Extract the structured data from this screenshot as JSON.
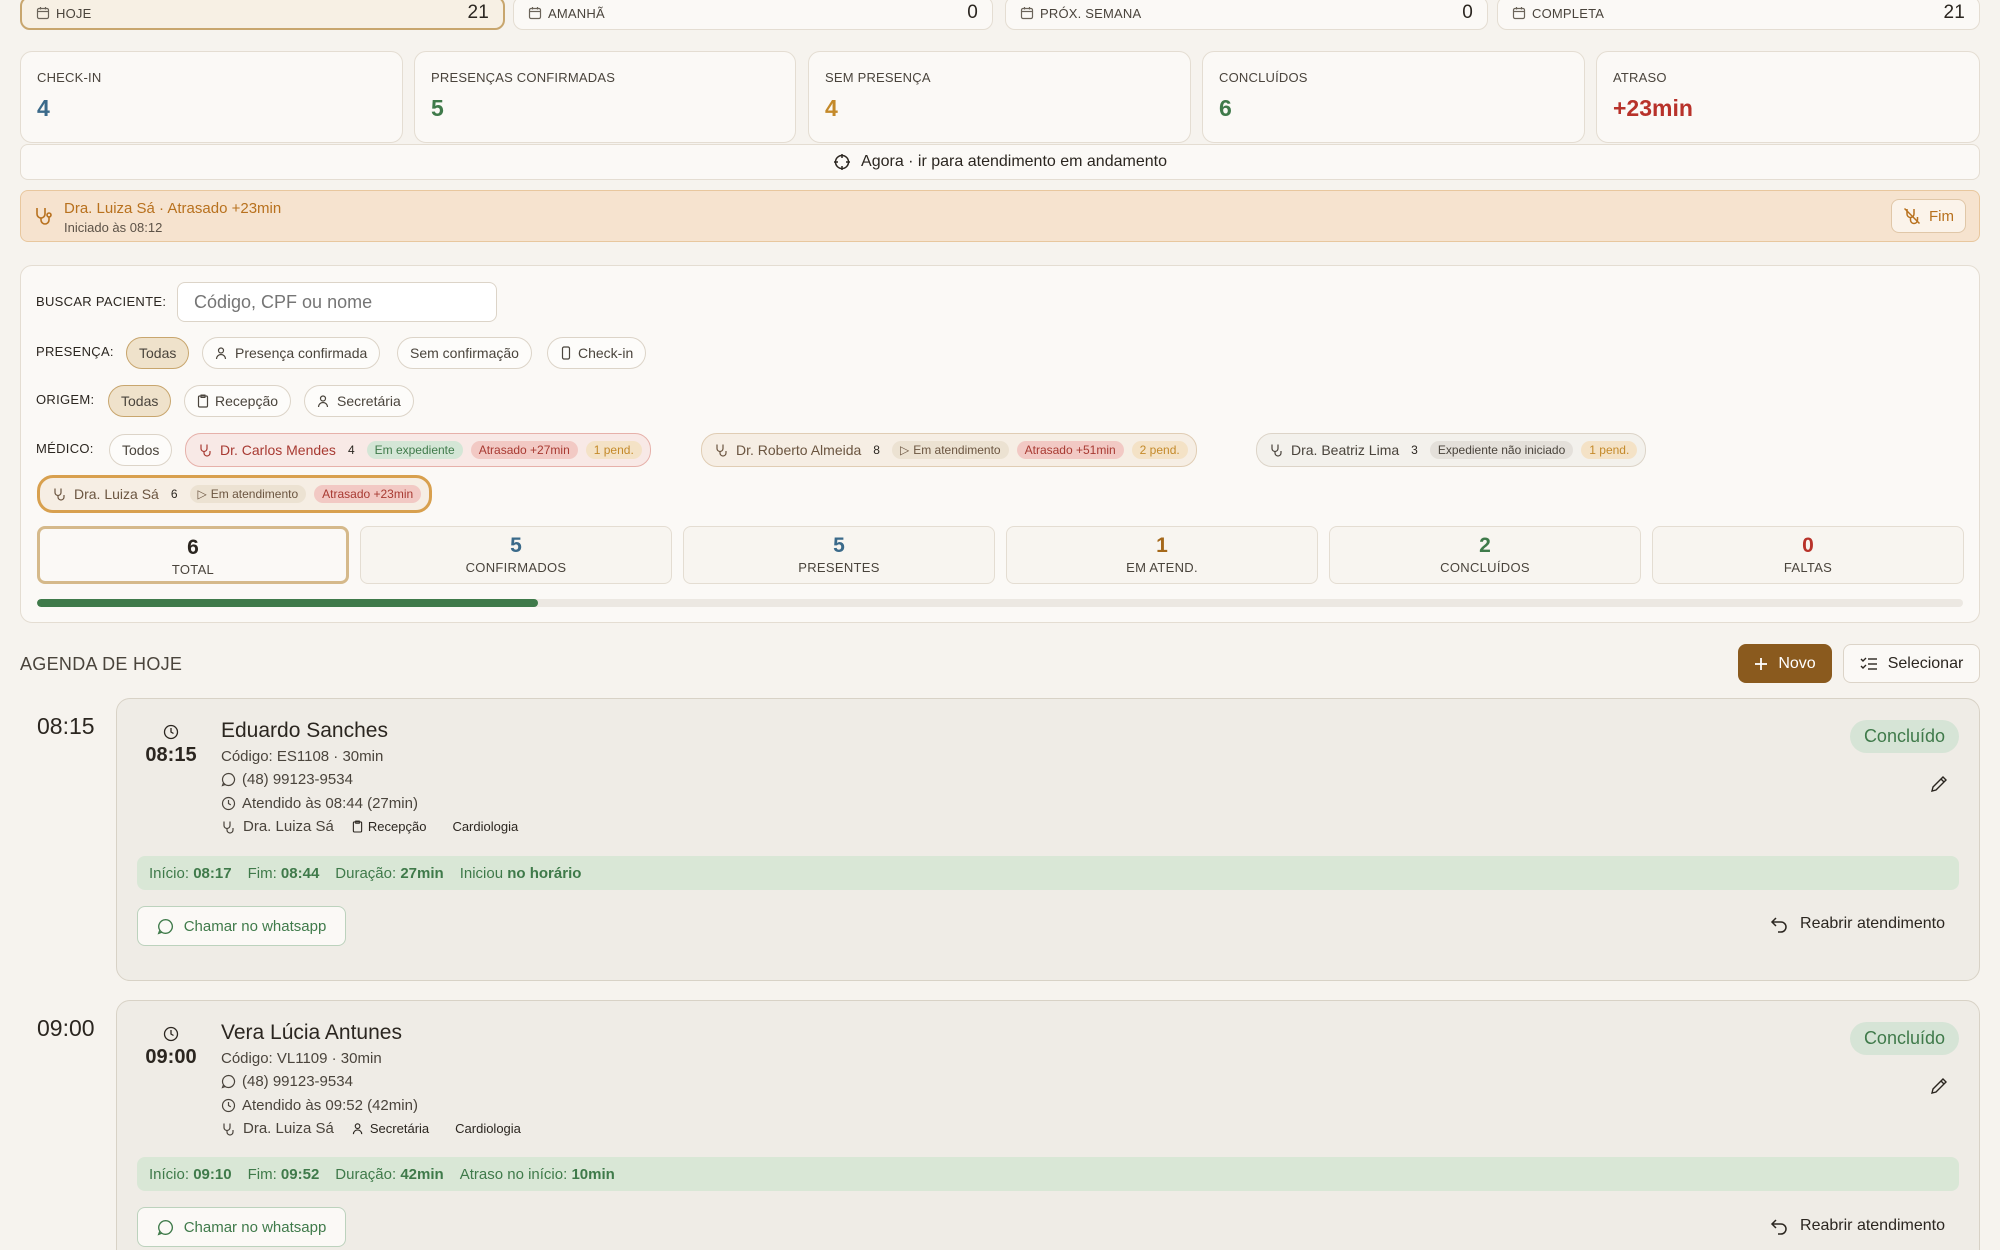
{
  "period_tabs": [
    {
      "label": "HOJE",
      "count": "21"
    },
    {
      "label": "AMANHÃ",
      "count": "0"
    },
    {
      "label": "PRÓX. SEMANA",
      "count": "0"
    },
    {
      "label": "COMPLETA",
      "count": "21"
    }
  ],
  "stats": [
    {
      "label": "CHECK-IN",
      "value": "4",
      "color": "#3b6a8a"
    },
    {
      "label": "PRESENÇAS CONFIRMADAS",
      "value": "5",
      "color": "#3f7a4a"
    },
    {
      "label": "SEM PRESENÇA",
      "value": "4",
      "color": "#c48a2a"
    },
    {
      "label": "CONCLUÍDOS",
      "value": "6",
      "color": "#3f7a4a"
    },
    {
      "label": "ATRASO",
      "value": "+23min",
      "color": "#b8322a"
    }
  ],
  "now_bar": {
    "label": "Agora · ir para atendimento em andamento"
  },
  "alert": {
    "title": "Dra. Luiza Sá · Atrasado +23min",
    "subtitle": "Iniciado às 08:12",
    "end_button": "Fim"
  },
  "filters": {
    "search_label": "BUSCAR PACIENTE:",
    "search_placeholder": "Código, CPF ou nome",
    "presence_label": "PRESENÇA:",
    "presence_options": [
      "Todas",
      "Presença confirmada",
      "Sem confirmação",
      "Check-in"
    ],
    "origin_label": "ORIGEM:",
    "origin_options": [
      "Todas",
      "Recepção",
      "Secretária"
    ],
    "doctor_label": "MÉDICO:",
    "doctor_all": "Todos",
    "doctors": [
      {
        "name": "Dr. Carlos Mendes",
        "count": "4",
        "status": "Em expediente",
        "delay": "Atrasado +27min",
        "pending": "1 pend."
      },
      {
        "name": "Dr. Roberto Almeida",
        "count": "8",
        "status": "Em atendimento",
        "delay": "Atrasado +51min",
        "pending": "2 pend."
      },
      {
        "name": "Dra. Beatriz Lima",
        "count": "3",
        "status": "Expediente não iniciado",
        "pending": "1 pend."
      },
      {
        "name": "Dra. Luiza Sá",
        "count": "6",
        "status": "Em atendimento",
        "delay": "Atrasado +23min"
      }
    ]
  },
  "summary": [
    {
      "value": "6",
      "label": "TOTAL",
      "color": "#2b2620"
    },
    {
      "value": "5",
      "label": "CONFIRMADOS",
      "color": "#3b6a8a"
    },
    {
      "value": "5",
      "label": "PRESENTES",
      "color": "#3b6a8a"
    },
    {
      "value": "1",
      "label": "EM ATEND.",
      "color": "#a5681a"
    },
    {
      "value": "2",
      "label": "CONCLUÍDOS",
      "color": "#3f7a4a"
    },
    {
      "value": "0",
      "label": "FALTAS",
      "color": "#b8322a"
    }
  ],
  "progress": {
    "fraction": 0.26
  },
  "agenda": {
    "title": "AGENDA DE HOJE",
    "new_button": "Novo",
    "select_button": "Selecionar"
  },
  "appointments": [
    {
      "time": "08:15",
      "name": "Eduardo Sanches",
      "code_line": "Código: ES1108 · 30min",
      "phone": "(48) 99123-9534",
      "attended": "Atendido às 08:44 (27min)",
      "doctor": "Dra. Luiza Sá",
      "origin": "Recepção",
      "specialty": "Cardiologia",
      "status": "Concluído",
      "timing": {
        "start_label": "Início:",
        "start": "08:17",
        "end_label": "Fim:",
        "end": "08:44",
        "dur_label": "Duração:",
        "dur": "27min",
        "note_label": "Iniciou",
        "note": "no horário"
      },
      "whatsapp": "Chamar no whatsapp",
      "reopen": "Reabrir atendimento"
    },
    {
      "time": "09:00",
      "name": "Vera Lúcia Antunes",
      "code_line": "Código: VL1109 · 30min",
      "phone": "(48) 99123-9534",
      "attended": "Atendido às 09:52 (42min)",
      "doctor": "Dra. Luiza Sá",
      "origin": "Secretária",
      "specialty": "Cardiologia",
      "status": "Concluído",
      "timing": {
        "start_label": "Início:",
        "start": "09:10",
        "end_label": "Fim:",
        "end": "09:52",
        "dur_label": "Duração:",
        "dur": "42min",
        "note_label": "Atraso no início:",
        "note": "10min"
      },
      "whatsapp": "Chamar no whatsapp",
      "reopen": "Reabrir atendimento"
    }
  ]
}
